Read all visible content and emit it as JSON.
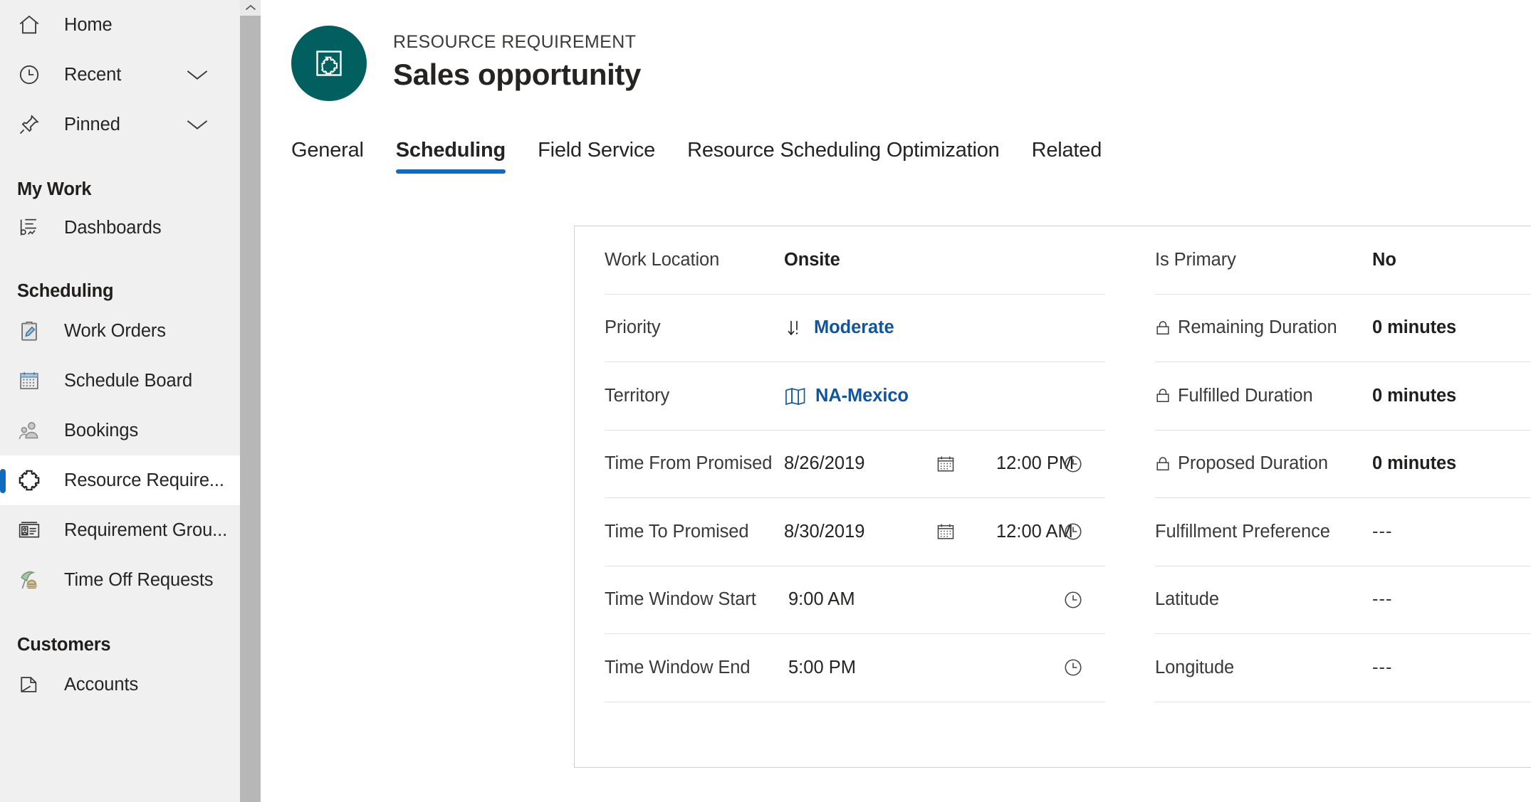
{
  "sidebar": {
    "top_items": [
      {
        "label": "Home",
        "icon": "home-icon",
        "chevron": false
      },
      {
        "label": "Recent",
        "icon": "clock-icon",
        "chevron": true
      },
      {
        "label": "Pinned",
        "icon": "pin-icon",
        "chevron": true
      }
    ],
    "groups": [
      {
        "title": "My Work",
        "items": [
          {
            "label": "Dashboards",
            "icon": "dashboard-icon",
            "selected": false
          }
        ]
      },
      {
        "title": "Scheduling",
        "items": [
          {
            "label": "Work Orders",
            "icon": "clipboard-pencil-icon",
            "selected": false
          },
          {
            "label": "Schedule Board",
            "icon": "calendar-grid-icon",
            "selected": false
          },
          {
            "label": "Bookings",
            "icon": "people-icon",
            "selected": false
          },
          {
            "label": "Resource Require...",
            "icon": "puzzle-icon",
            "selected": true
          },
          {
            "label": "Requirement Grou...",
            "icon": "contact-card-icon",
            "selected": false
          },
          {
            "label": "Time Off Requests",
            "icon": "beach-umbrella-icon",
            "selected": false
          }
        ]
      },
      {
        "title": "Customers",
        "items": [
          {
            "label": "Accounts",
            "icon": "folder-icon",
            "selected": false
          }
        ]
      }
    ],
    "scrollbar": {
      "up_icon": "chevron-up-icon"
    }
  },
  "record": {
    "entity_label": "RESOURCE REQUIREMENT",
    "title": "Sales opportunity",
    "avatar_icon": "puzzle-framed-icon",
    "avatar_color": "#015F60"
  },
  "tabs": [
    {
      "label": "General",
      "active": false
    },
    {
      "label": "Scheduling",
      "active": true
    },
    {
      "label": "Field Service",
      "active": false
    },
    {
      "label": "Resource Scheduling Optimization",
      "active": false
    },
    {
      "label": "Related",
      "active": false
    }
  ],
  "accent_blue": "#0f6cbd",
  "link_blue": "#11559e",
  "form": {
    "left_column": [
      {
        "label": "Work Location",
        "value": "Onsite",
        "style": "bold"
      },
      {
        "label": "Priority",
        "value": "Moderate",
        "style": "link",
        "icon": "priority-down-arrow-icon"
      },
      {
        "label": "Territory",
        "value": "NA-Mexico",
        "style": "link",
        "icon": "map-icon"
      },
      {
        "label": "Time From Promised",
        "date": "8/26/2019",
        "time": "12:00 PM",
        "date_icon": "calendar-icon",
        "time_icon": "clock-icon"
      },
      {
        "label": "Time To Promised",
        "date": "8/30/2019",
        "time": "12:00 AM",
        "date_icon": "calendar-icon",
        "time_icon": "clock-icon"
      },
      {
        "label": "Time Window Start",
        "time": "9:00 AM",
        "time_icon": "clock-icon"
      },
      {
        "label": "Time Window End",
        "time": "5:00 PM",
        "time_icon": "clock-icon"
      }
    ],
    "right_column": [
      {
        "label": "Is Primary",
        "value": "No",
        "style": "bold",
        "locked": false
      },
      {
        "label": "Remaining Duration",
        "value": "0 minutes",
        "style": "bold",
        "locked": true,
        "lock_icon": "lock-icon"
      },
      {
        "label": "Fulfilled Duration",
        "value": "0 minutes",
        "style": "bold",
        "locked": true,
        "lock_icon": "lock-icon"
      },
      {
        "label": "Proposed Duration",
        "value": "0 minutes",
        "style": "bold",
        "locked": true,
        "lock_icon": "lock-icon"
      },
      {
        "label": "Fulfillment Preference",
        "value": "---",
        "style": "empty",
        "locked": false
      },
      {
        "label": "Latitude",
        "value": "---",
        "style": "empty",
        "locked": false
      },
      {
        "label": "Longitude",
        "value": "---",
        "style": "empty",
        "locked": false
      }
    ]
  }
}
